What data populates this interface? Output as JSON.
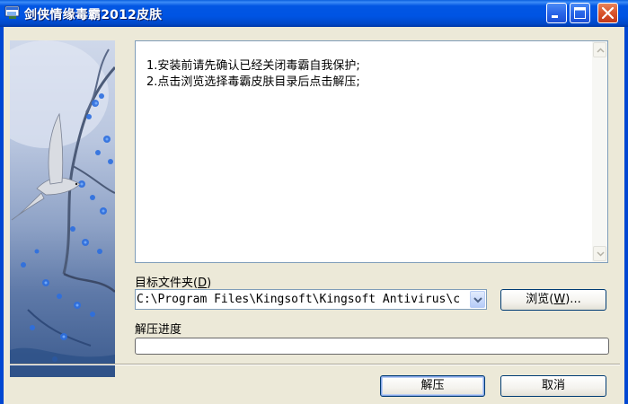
{
  "window": {
    "title": "剑侠情缘毒霸2012皮肤"
  },
  "info": {
    "lines": [
      "1.安装前请先确认已经关闭毒霸自我保护;",
      "2.点击浏览选择毒霸皮肤目录后点击解压;"
    ]
  },
  "target_folder": {
    "label": "目标文件夹",
    "accel_open": "(",
    "accel_key": "D",
    "accel_close": ")",
    "path_value": "C:\\Program Files\\Kingsoft\\Kingsoft Antivirus\\c",
    "browse_label_pre": "浏览(",
    "browse_accel": "W",
    "browse_label_post": ")..."
  },
  "progress": {
    "label": "解压进度",
    "value": 0
  },
  "buttons": {
    "extract": "解压",
    "cancel": "取消"
  },
  "colors": {
    "titlebar": "#0054E3",
    "dialog_bg": "#ECE9D8",
    "field_border": "#7F9DB9",
    "button_border": "#003C74"
  },
  "icons": {
    "app": "installer-window-icon",
    "minimize": "minimize-icon",
    "maximize": "maximize-icon",
    "close": "close-icon",
    "dropdown": "chevron-down-icon"
  }
}
